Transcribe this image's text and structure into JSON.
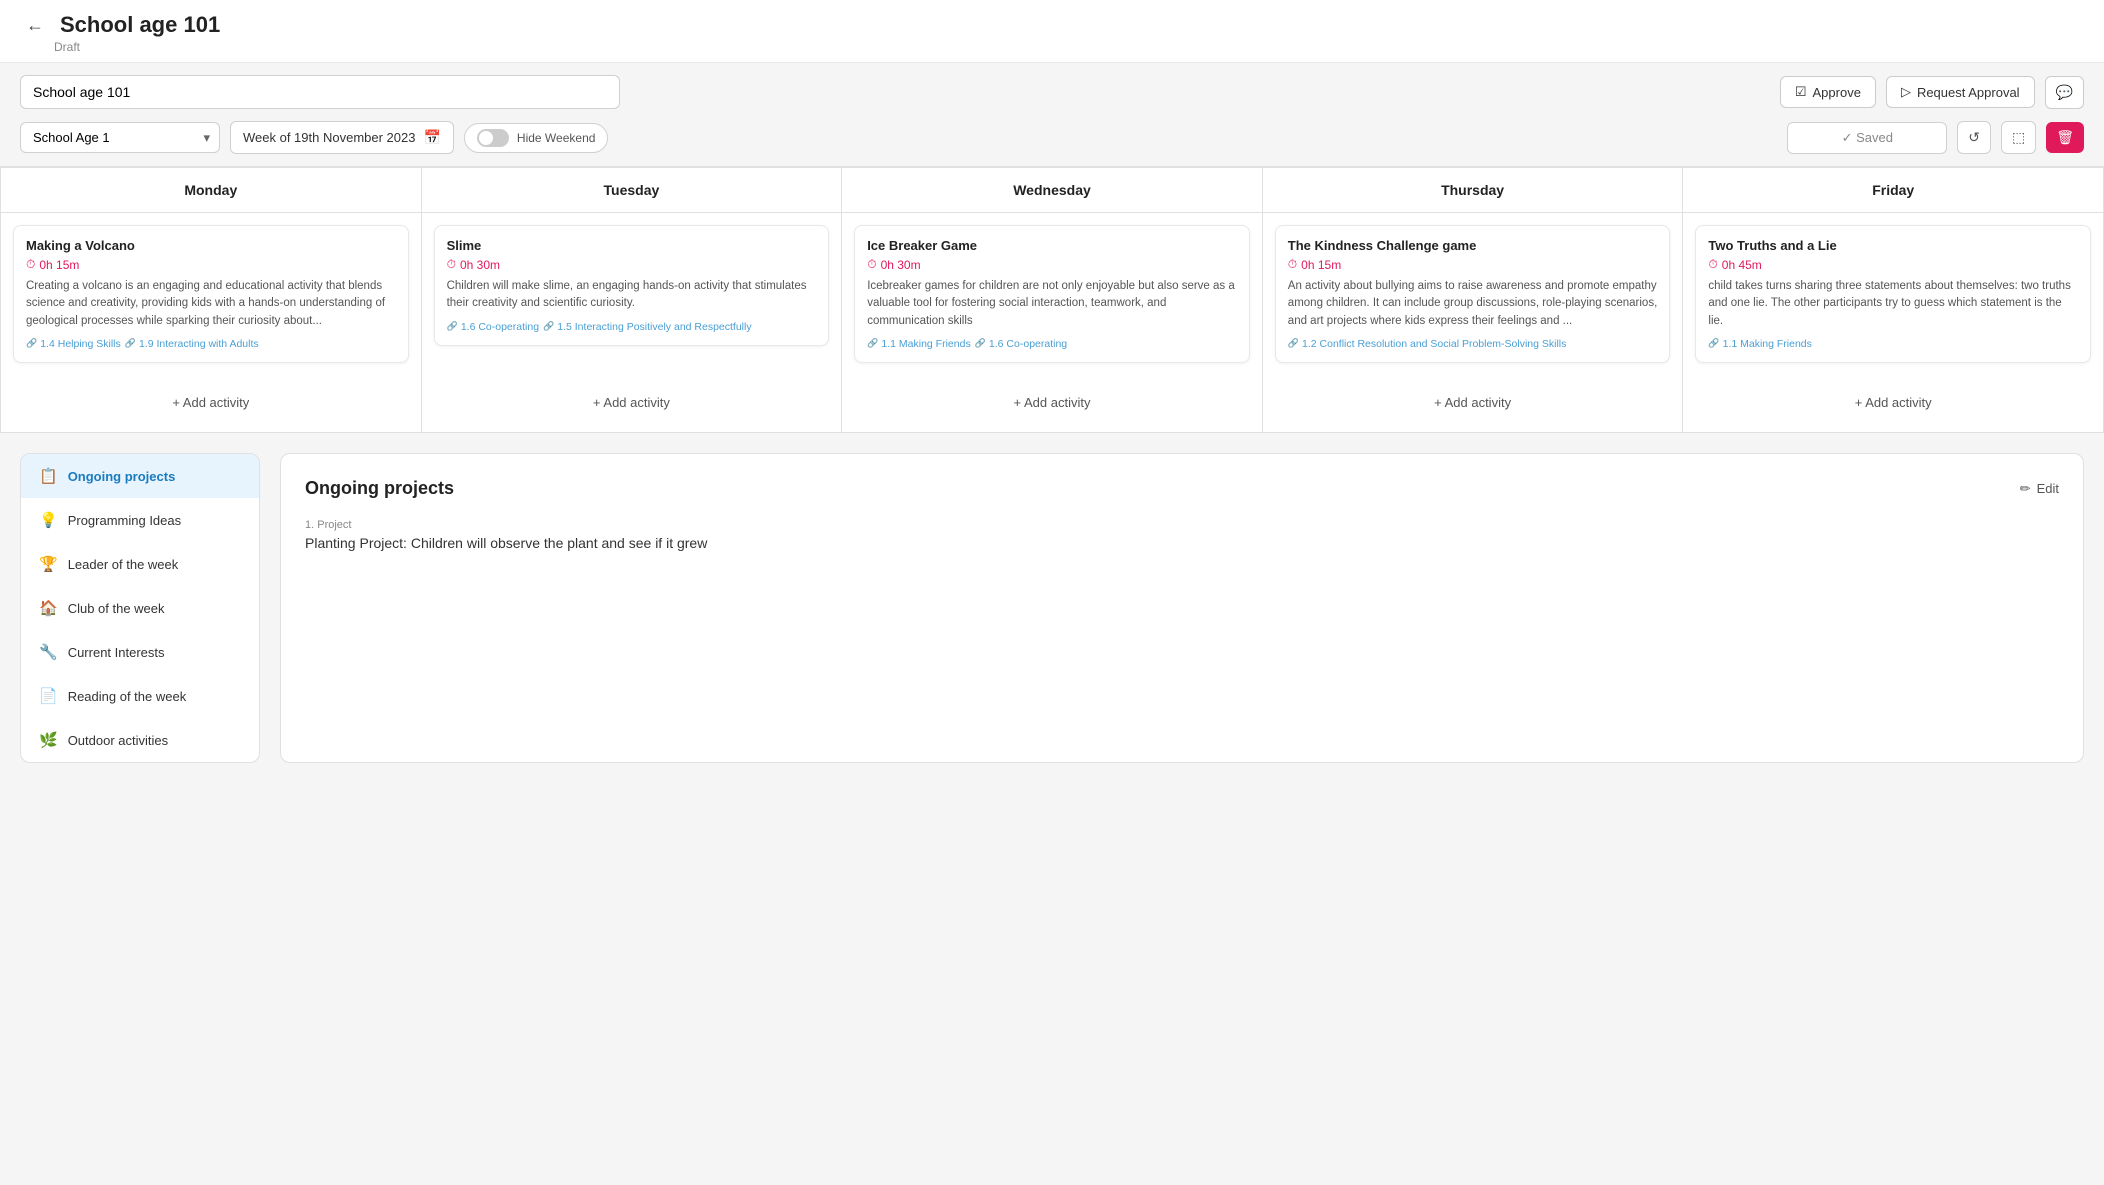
{
  "header": {
    "back_label": "←",
    "title": "School age 101",
    "status": "Draft"
  },
  "toolbar": {
    "plan_name": "School age 101",
    "approve_label": "Approve",
    "request_approval_label": "Request Approval",
    "saved_label": "✓  Saved",
    "class_select_value": "School Age 1",
    "week_label": "Week of 19th November 2023",
    "hide_weekend_label": "Hide Weekend"
  },
  "calendar": {
    "days": [
      "Monday",
      "Tuesday",
      "Wednesday",
      "Thursday",
      "Friday"
    ],
    "activities": [
      {
        "day": "Monday",
        "title": "Making a Volcano",
        "time": "0h 15m",
        "desc": "Creating a volcano is an engaging and educational activity that blends science and creativity, providing kids with a hands-on understanding of geological processes while sparking their curiosity about...",
        "tags": [
          "1.4 Helping Skills",
          "1.9 Interacting with Adults"
        ]
      },
      {
        "day": "Tuesday",
        "title": "Slime",
        "time": "0h 30m",
        "desc": "Children will make slime, an engaging hands-on activity that stimulates their creativity and scientific curiosity.",
        "tags": [
          "1.6 Co-operating",
          "1.5 Interacting Positively and Respectfully"
        ]
      },
      {
        "day": "Wednesday",
        "title": "Ice Breaker Game",
        "time": "0h 30m",
        "desc": "Icebreaker games for children are not only enjoyable but also serve as a valuable tool for fostering social interaction, teamwork, and communication skills",
        "tags": [
          "1.1 Making Friends",
          "1.6 Co-operating"
        ]
      },
      {
        "day": "Thursday",
        "title": "The Kindness Challenge game",
        "time": "0h 15m",
        "desc": "An activity about bullying aims to raise awareness and promote empathy among children. It can include group discussions, role-playing scenarios, and art projects where kids express their feelings and ...",
        "tags": [
          "1.2 Conflict Resolution and Social Problem-Solving Skills"
        ]
      },
      {
        "day": "Friday",
        "title": "Two Truths and a Lie",
        "time": "0h 45m",
        "desc": "child takes turns sharing three statements about themselves: two truths and one lie. The other participants try to guess which statement is the lie.",
        "tags": [
          "1.1 Making Friends"
        ]
      }
    ],
    "add_activity_label": "+ Add activity"
  },
  "sidebar": {
    "items": [
      {
        "label": "Ongoing projects",
        "icon": "📋",
        "active": true
      },
      {
        "label": "Programming Ideas",
        "icon": "💡",
        "active": false
      },
      {
        "label": "Leader of the week",
        "icon": "🏆",
        "active": false
      },
      {
        "label": "Club of the week",
        "icon": "🏠",
        "active": false
      },
      {
        "label": "Current Interests",
        "icon": "🔧",
        "active": false
      },
      {
        "label": "Reading of the week",
        "icon": "📄",
        "active": false
      },
      {
        "label": "Outdoor activities",
        "icon": "🌿",
        "active": false
      }
    ]
  },
  "ongoing_projects": {
    "title": "Ongoing projects",
    "edit_label": "Edit",
    "project_label": "1. Project",
    "project_name": "Planting Project: Children will observe the plant and see if it grew"
  }
}
